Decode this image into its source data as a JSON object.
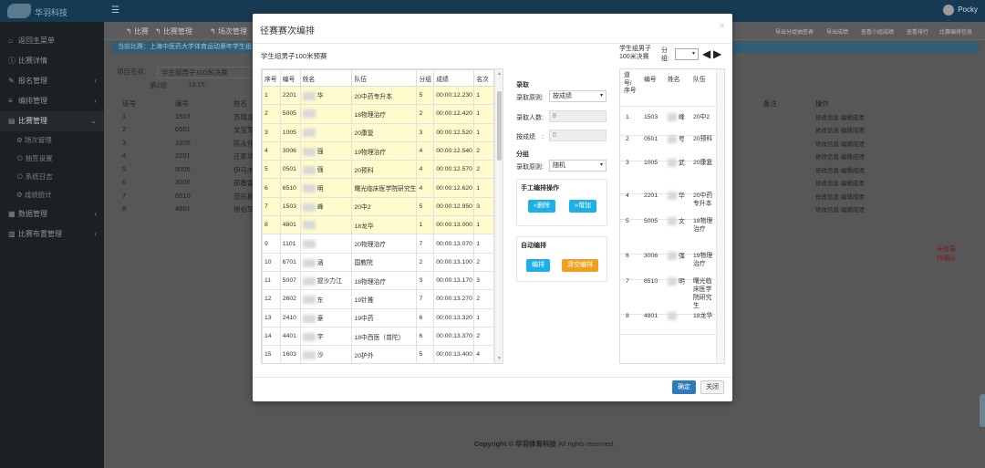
{
  "app": {
    "user": "Pocky",
    "copyright_prefix": "Copyright ©",
    "company": "华羽体育科技",
    "copyright_suffix": "All rights reserved."
  },
  "sidebar": {
    "items": [
      {
        "label": "返回主菜单"
      },
      {
        "label": "比赛详情"
      },
      {
        "label": "报名管理"
      },
      {
        "label": "编排管理"
      },
      {
        "label": "比赛管理"
      },
      {
        "label": "场次管理"
      },
      {
        "label": "抽签设置"
      },
      {
        "label": "系统日志"
      },
      {
        "label": "成绩统计"
      },
      {
        "label": "数据管理"
      },
      {
        "label": "比赛布置管理"
      }
    ]
  },
  "breadcrumb": {
    "b1": "比赛",
    "b2": "比赛管理",
    "b3": "场次管理",
    "r1": "导出分组抽签表",
    "r2": "导出成绩",
    "r3": "查看小组成绩",
    "r4": "查看排行",
    "r5": "比赛编排信息"
  },
  "infobar": "当前比赛：上海中医药大学体育运动第年学生组",
  "background": {
    "project_label": "项目名称：",
    "project_value": "学生组男子100米决赛",
    "group": "第2组",
    "time": "13:15",
    "headers": {
      "lane": "道号",
      "num": "编号",
      "name": "姓名",
      "remark": "备注",
      "op": "操作"
    },
    "rows": [
      {
        "lane": "1",
        "num": "1503",
        "name": "苏晓龙"
      },
      {
        "lane": "2",
        "num": "0501",
        "name": "文宝军"
      },
      {
        "lane": "3",
        "num": "1005",
        "name": "陈永伟"
      },
      {
        "lane": "4",
        "num": "2201",
        "name": "庄家华"
      },
      {
        "lane": "5",
        "num": "5005",
        "name": "伊马木"
      },
      {
        "lane": "6",
        "num": "3006",
        "name": "邢春雷"
      },
      {
        "lane": "7",
        "num": "6510",
        "name": "范乐斯"
      },
      {
        "lane": "8",
        "num": "4801",
        "name": "徐伯军"
      }
    ],
    "op_label": "修改信息 编辑成绩",
    "note1": "未检录",
    "note2": "待确认"
  },
  "modal": {
    "title": "径赛赛次编排",
    "caption": "学生组男子100米预赛",
    "headers": {
      "idx": "序号",
      "num": "编号",
      "name": "姓名",
      "team": "队伍",
      "group": "分组",
      "score": "成绩",
      "rank": "名次"
    },
    "rows": [
      {
        "idx": "1",
        "num": "2201",
        "name": "华",
        "team": "20中药专升本",
        "group": "5",
        "score": "00:00:12.230",
        "rank": "1"
      },
      {
        "idx": "2",
        "num": "5005",
        "name": "",
        "team": "18物理治疗",
        "group": "2",
        "score": "00:00:12.420",
        "rank": "1"
      },
      {
        "idx": "3",
        "num": "1005",
        "name": "",
        "team": "20康复",
        "group": "3",
        "score": "00:00:12.520",
        "rank": "1"
      },
      {
        "idx": "4",
        "num": "3006",
        "name": "强",
        "team": "19物理治疗",
        "group": "4",
        "score": "00:00:12.540",
        "rank": "2"
      },
      {
        "idx": "5",
        "num": "0501",
        "name": "强",
        "team": "20预科",
        "group": "4",
        "score": "00:00:12.570",
        "rank": "2"
      },
      {
        "idx": "6",
        "num": "6510",
        "name": "明",
        "team": "曙光临床医学院研究生",
        "group": "4",
        "score": "00:00:12.620",
        "rank": "1"
      },
      {
        "idx": "7",
        "num": "1503",
        "name": "峰",
        "team": "20中2",
        "group": "5",
        "score": "00:00:12.950",
        "rank": "3"
      },
      {
        "idx": "8",
        "num": "4801",
        "name": "",
        "team": "18龙华",
        "group": "1",
        "score": "00:00:13.000",
        "rank": "1"
      },
      {
        "idx": "9",
        "num": "1101",
        "name": "",
        "team": "20物理治疗",
        "group": "7",
        "score": "00:00:13.070",
        "rank": "1"
      },
      {
        "idx": "10",
        "num": "6701",
        "name": "涵",
        "team": "国教院",
        "group": "2",
        "score": "00:00:13.100",
        "rank": "2"
      },
      {
        "idx": "11",
        "num": "5007",
        "name": "提沙力江",
        "team": "18物理治疗",
        "group": "3",
        "score": "00:00:13.170",
        "rank": "3"
      },
      {
        "idx": "12",
        "num": "2602",
        "name": "东",
        "team": "19针推",
        "group": "7",
        "score": "00:00:13.270",
        "rank": "2"
      },
      {
        "idx": "13",
        "num": "2410",
        "name": "豪",
        "team": "19中药",
        "group": "6",
        "score": "00:00:13.320",
        "rank": "1"
      },
      {
        "idx": "14",
        "num": "4401",
        "name": "宇",
        "team": "18中西医（普陀）",
        "group": "6",
        "score": "00:00:13.370",
        "rank": "2"
      },
      {
        "idx": "15",
        "num": "1603",
        "name": "沙",
        "team": "20护外",
        "group": "5",
        "score": "00:00:13.400",
        "rank": "4"
      }
    ],
    "selected_count": 8,
    "lq": {
      "title": "录取",
      "rule_label": "录取原则:",
      "rule_value": "按成绩",
      "count_label": "录取人数:",
      "count_value": "8",
      "by_score_label": "按成绩　:",
      "by_score_value": "0"
    },
    "fz": {
      "title": "分组",
      "rule_label": "录取原则:",
      "rule_value": "随机"
    },
    "manual": {
      "title": "手工编排操作",
      "remove": "«删除",
      "add": "»增加"
    },
    "auto": {
      "title": "自动编排",
      "arrange": "编排",
      "clear": "清空编排"
    },
    "right": {
      "caption_l1": "学生组男子",
      "caption_l2": "100米决赛",
      "group_l1": "分",
      "group_l2": "组:",
      "headers": {
        "lane": "道号/序号",
        "num": "编号",
        "name": "姓名",
        "team": "队伍"
      },
      "rows": [
        {
          "lane": "1",
          "num": "1503",
          "name": "峰",
          "team": "20中2"
        },
        {
          "lane": "2",
          "num": "0501",
          "name": "号",
          "team": "20预科"
        },
        {
          "lane": "3",
          "num": "1005",
          "name": "武",
          "team": "20康复"
        },
        {
          "lane": "4",
          "num": "2201",
          "name": "华",
          "team": "20中药专升本"
        },
        {
          "lane": "5",
          "num": "5005",
          "name": "文",
          "team": "18物理治疗"
        },
        {
          "lane": "6",
          "num": "3006",
          "name": "强",
          "team": "19物理治疗"
        },
        {
          "lane": "7",
          "num": "6510",
          "name": "明",
          "team": "曙光临床医学院研究生"
        },
        {
          "lane": "8",
          "num": "4801",
          "name": "",
          "team": "18龙华"
        }
      ]
    },
    "ok": "确定",
    "cancel": "关闭"
  }
}
